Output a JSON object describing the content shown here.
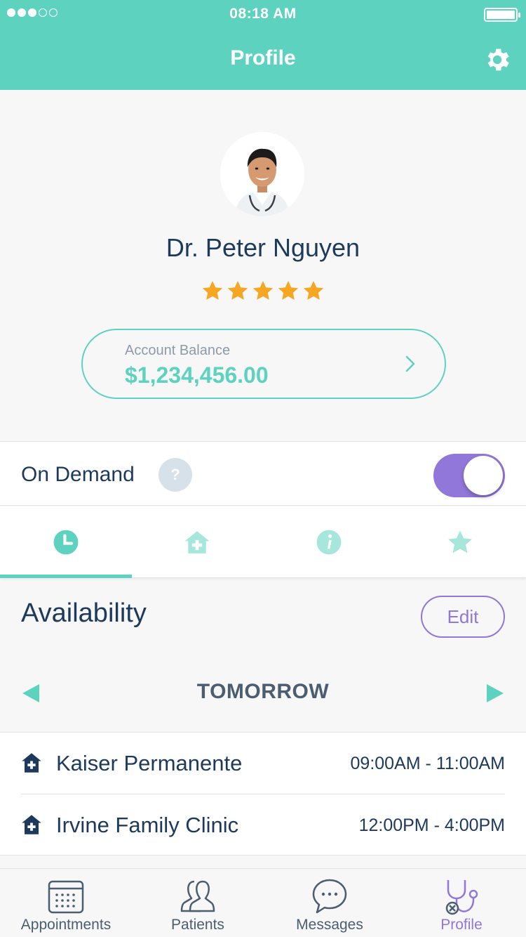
{
  "status_bar": {
    "time": "08:18 AM"
  },
  "header": {
    "title": "Profile",
    "settings_icon": "gear-icon"
  },
  "profile": {
    "name": "Dr. Peter Nguyen",
    "rating": 4.5,
    "rating_max": 5,
    "balance_label": "Account Balance",
    "balance_value": "$1,234,456.00"
  },
  "on_demand": {
    "label": "On Demand",
    "help": "?",
    "enabled": true
  },
  "tabs": [
    {
      "icon": "clock-icon",
      "active": true
    },
    {
      "icon": "hospital-icon",
      "active": false
    },
    {
      "icon": "info-icon",
      "active": false
    },
    {
      "icon": "star-icon",
      "active": false
    }
  ],
  "availability": {
    "title": "Availability",
    "edit_label": "Edit",
    "day": "TOMORROW",
    "slots": [
      {
        "name": "Kaiser Permanente",
        "time": "09:00AM - 11:00AM"
      },
      {
        "name": "Irvine Family Clinic",
        "time": "12:00PM - 4:00PM"
      }
    ]
  },
  "bottom_nav": [
    {
      "label": "Appointments",
      "icon": "calendar-icon",
      "active": false
    },
    {
      "label": "Patients",
      "icon": "patients-icon",
      "active": false
    },
    {
      "label": "Messages",
      "icon": "chat-icon",
      "active": false
    },
    {
      "label": "Profile",
      "icon": "stethoscope-icon",
      "active": true
    }
  ],
  "colors": {
    "accent": "#5dd3bf",
    "purple": "#9177d9",
    "navy": "#1d3a5c",
    "star": "#f5a623"
  }
}
